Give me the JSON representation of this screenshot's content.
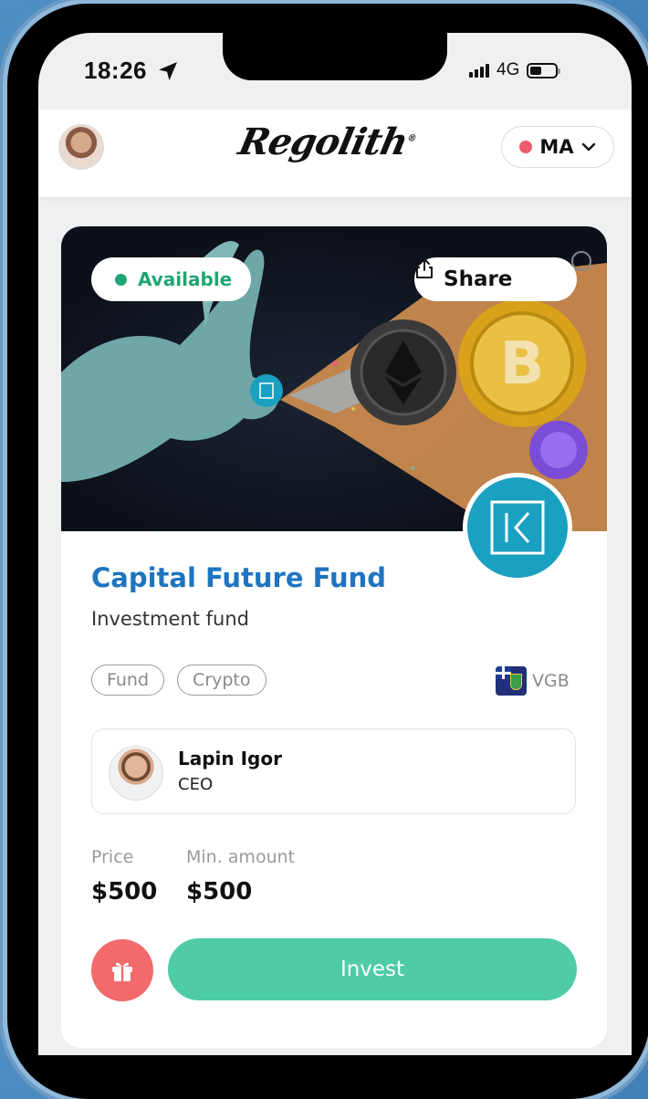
{
  "status_bar": {
    "time": "18:26",
    "network": "4G"
  },
  "header": {
    "brand": "REGOLITH",
    "region": {
      "label": "MA"
    }
  },
  "card": {
    "status_badge": "Available",
    "share_label": "Share",
    "title": "Capital Future Fund",
    "subtitle": "Investment fund",
    "tags": [
      "Fund",
      "Crypto"
    ],
    "country_code": "VGB",
    "contact": {
      "name": "Lapin Igor",
      "role": "CEO"
    },
    "price_label": "Price",
    "price_value": "$500",
    "min_amount_label": "Min. amount",
    "min_amount_value": "$500",
    "invest_label": "Invest"
  },
  "colors": {
    "accent_blue": "#1e74c0",
    "available_green": "#1ea672",
    "invest_green": "#4fcca6",
    "gift_red": "#f26a6a",
    "region_dot": "#ee5b6c",
    "fund_logo_teal": "#1aa0c0"
  },
  "icons": [
    "location-arrow-icon",
    "signal-icon",
    "battery-icon",
    "chevron-down-icon",
    "share-icon",
    "gift-icon",
    "fund-logo-icon"
  ]
}
